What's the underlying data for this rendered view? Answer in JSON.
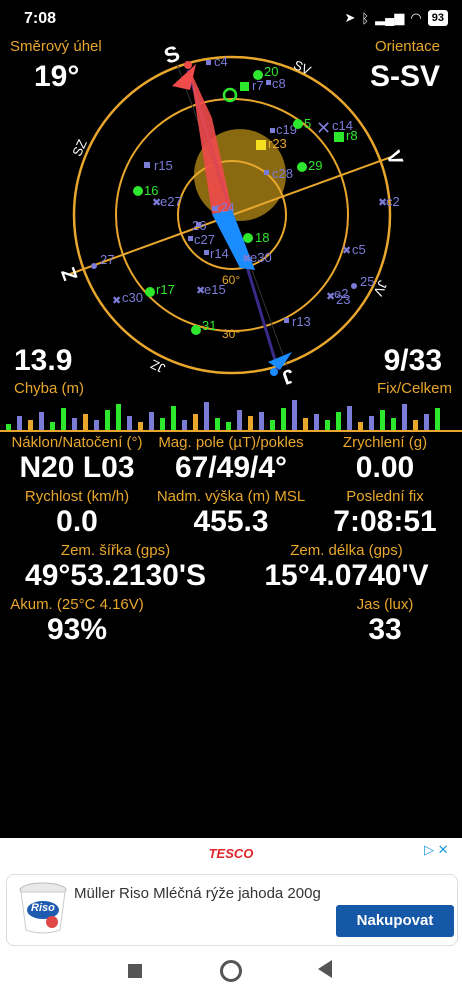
{
  "status": {
    "time": "7:08",
    "battery": "93"
  },
  "compass": {
    "heading_label": "Směrový úhel",
    "heading_value": "19°",
    "orientation_label": "Orientace",
    "orientation_value": "S-SV",
    "error_value": "13.9",
    "error_label": "Chyba (m)",
    "fix_value": "9/33",
    "fix_label": "Fix/Celkem",
    "directions": {
      "north": "S",
      "east": "V",
      "south": "J",
      "west": "Z",
      "ne": "SV",
      "nw": "SZ",
      "se": "JV",
      "sw": "JZ"
    },
    "ring_labels": {
      "sixty": "60°",
      "thirty": "30°"
    }
  },
  "satellites": [
    {
      "id": "c4",
      "kind": "c"
    },
    {
      "id": "20",
      "kind": "n"
    },
    {
      "id": "c8",
      "kind": "c"
    },
    {
      "id": "r7",
      "kind": "r"
    },
    {
      "id": "c19",
      "kind": "c"
    },
    {
      "id": "5",
      "kind": "n"
    },
    {
      "id": "c14",
      "kind": "c"
    },
    {
      "id": "r8",
      "kind": "r"
    },
    {
      "id": "r23",
      "kind": "r"
    },
    {
      "id": "r15",
      "kind": "r"
    },
    {
      "id": "c28",
      "kind": "c"
    },
    {
      "id": "29",
      "kind": "n"
    },
    {
      "id": "16",
      "kind": "n"
    },
    {
      "id": "e27",
      "kind": "e"
    },
    {
      "id": "c2",
      "kind": "c"
    },
    {
      "id": "r24",
      "kind": "r"
    },
    {
      "id": "26",
      "kind": "n"
    },
    {
      "id": "18",
      "kind": "n"
    },
    {
      "id": "c27",
      "kind": "c"
    },
    {
      "id": "r14",
      "kind": "r"
    },
    {
      "id": "e30",
      "kind": "e"
    },
    {
      "id": "c5",
      "kind": "c"
    },
    {
      "id": "27",
      "kind": "n"
    },
    {
      "id": "e15",
      "kind": "e"
    },
    {
      "id": "25",
      "kind": "n"
    },
    {
      "id": "e2",
      "kind": "e"
    },
    {
      "id": "23",
      "kind": "n"
    },
    {
      "id": "c30",
      "kind": "c"
    },
    {
      "id": "r17",
      "kind": "r"
    },
    {
      "id": "r13",
      "kind": "r"
    },
    {
      "id": "31",
      "kind": "n"
    }
  ],
  "stats": {
    "tilt_label": "Náklon/Natočení (°)",
    "tilt_value": "N20 L03",
    "mag_label": "Mag. pole (µT)/pokles",
    "mag_value": "67/49/4°",
    "accel_label": "Zrychlení (g)",
    "accel_value": "0.00",
    "speed_label": "Rychlost (km/h)",
    "speed_value": "0.0",
    "alt_label": "Nadm. výška (m) MSL",
    "alt_value": "455.3",
    "lastfix_label": "Poslední fix",
    "lastfix_value": "7:08:51",
    "lat_label": "Zem. šířka (gps)",
    "lat_value": "49°53.2130'S",
    "lon_label": "Zem. délka (gps)",
    "lon_value": "15°4.0740'V",
    "battery_label": "Akum. (25°C 4.16V)",
    "battery_value": "93%",
    "light_label": "Jas (lux)",
    "light_value": "33"
  },
  "ad": {
    "brand": "TESCO",
    "title": "Müller Riso Mléčná rýže jahoda 200g",
    "button": "Nakupovat",
    "product_text": "Riso"
  },
  "colors": {
    "accent": "#e8a72c",
    "green": "#2ee82e",
    "blue": "#7b7bd8",
    "red": "#f04a4a",
    "needle_blue": "#1a8cff"
  }
}
